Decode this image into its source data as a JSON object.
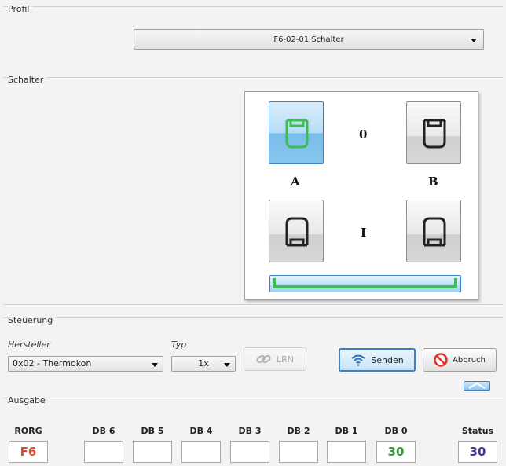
{
  "profil": {
    "group_label": "Profil",
    "selected": "F6-02-01 Schalter"
  },
  "schalter": {
    "group_label": "Schalter",
    "state_top": "0",
    "state_bottom": "I",
    "channel_a": "A",
    "channel_b": "B",
    "accent_active": "#3cbd4f"
  },
  "steuerung": {
    "group_label": "Steuerung",
    "hersteller_label": "Hersteller",
    "hersteller_value": "0x02 - Thermokon",
    "typ_label": "Typ",
    "typ_value": "1x",
    "lrn_label": "LRN",
    "senden_label": "Senden",
    "abbruch_label": "Abbruch"
  },
  "ausgabe": {
    "group_label": "Ausgabe",
    "columns": [
      {
        "header": "RORG",
        "value": "F6",
        "color": "#e8452c"
      },
      {
        "header": "DB 6",
        "value": "",
        "color": "#222222"
      },
      {
        "header": "DB 5",
        "value": "",
        "color": "#222222"
      },
      {
        "header": "DB 4",
        "value": "",
        "color": "#222222"
      },
      {
        "header": "DB 3",
        "value": "",
        "color": "#222222"
      },
      {
        "header": "DB 2",
        "value": "",
        "color": "#222222"
      },
      {
        "header": "DB 1",
        "value": "",
        "color": "#222222"
      },
      {
        "header": "DB 0",
        "value": "30",
        "color": "#3a9a3a"
      },
      {
        "header": "Status",
        "value": "30",
        "color": "#4a2f9a"
      }
    ]
  }
}
